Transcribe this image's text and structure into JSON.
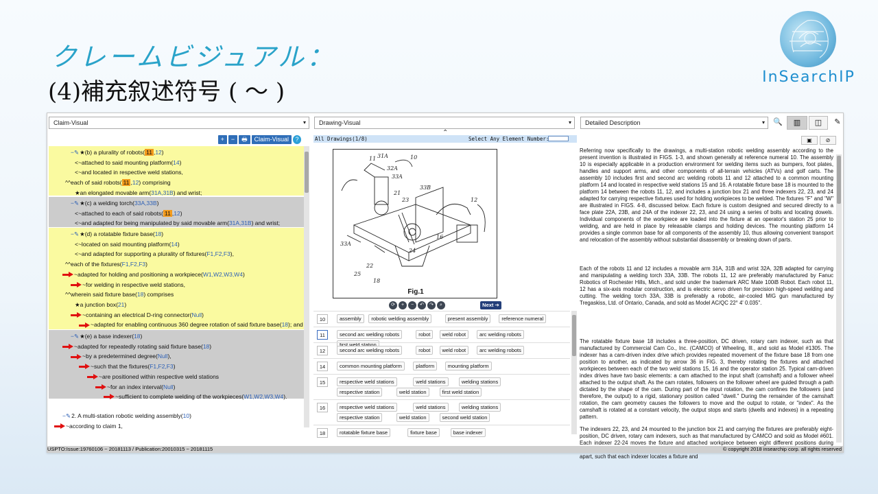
{
  "slide": {
    "title": "クレームビジュアル：",
    "subtitle": "(4)補充叙述符号 ( ～ )",
    "logo_text": "InSearchIP"
  },
  "selects": {
    "left": "Claim-Visual",
    "mid": "Drawing-Visual",
    "right": "Detailed Description"
  },
  "toolbar_icons": [
    "search-icon",
    "two-column-icon",
    "split-view-icon",
    "highlighter-icon"
  ],
  "left_tools": {
    "plus": "+",
    "minus": "−",
    "print": "🖶",
    "link": "☁",
    "view": "Claim-Visual",
    "help": "?"
  },
  "claims": {
    "b": [
      "★(b) a plurality of robots(",
      "11",
      ",",
      "12",
      ")",
      "<~attached to said mounting platform(",
      "14",
      ")",
      "<~and located in respective weld stations,",
      "^^each of said robots(",
      "11",
      ",",
      "12",
      ") comprising",
      "★an elongated movable arm(",
      "31A,31B",
      ") and wrist;"
    ],
    "c": [
      "★(c) a welding torch(",
      "33A,33B",
      ")",
      "<~attached to each of said robots(",
      "11",
      ",",
      "12",
      ")",
      "<~and adapted for being manipulated by said movable arm(",
      "31A,31B",
      ") and wrist;"
    ],
    "d": [
      "★(d) a rotatable fixture base(",
      "18",
      ")",
      "<~located on said mounting platform(",
      "14",
      ")",
      "<~and adapted for supporting a plurality of fixtures(",
      "F1,F2,F3",
      "),",
      "^^each of the fixtures(",
      "F1,F2,F3",
      ")",
      "~adapted for holding and positioning a workpiece(",
      "W1,W2,W3,W4",
      ")",
      "~for welding in respective weld stations,",
      "^^wherein said fixture base(",
      "18",
      ") comprises",
      "★a junction box(",
      "21",
      ")",
      "~containing an electrical D-ring connector(",
      "Null",
      ")",
      "~adapted for enabling continuous 360 degree rotation of said fixture base(",
      "18",
      "); and"
    ],
    "e": [
      "★(e) a base indexer(",
      "18",
      ")",
      "~adapted for repeatedly rotating said fixture base(",
      "18",
      ")",
      "~by a predetermined degree(",
      "Null",
      "),",
      "~such that the fixtures(",
      "F1,F2,F3",
      ")",
      "~are positioned within respective weld stations",
      "~for an index interval(",
      "Null",
      ")",
      "~sufficient to complete welding of the workpieces(",
      "W1,W2,W3,W4",
      ")."
    ],
    "c2": [
      "2. A multi-station robotic welding assembly(",
      "10",
      ")",
      "~according to claim 1,"
    ]
  },
  "drawing": {
    "header": "All Drawings(1/8)",
    "select_label": "Select Any Element Number:",
    "fig": "Fig.1",
    "next": "Next"
  },
  "element_rows": [
    {
      "num": "10",
      "tags": [
        "assembly",
        "robotic welding assembly",
        "present assembly",
        "reference numeral"
      ]
    },
    {
      "num": "11",
      "tags": [
        "second arc welding robots",
        "robot",
        "weld robot",
        "arc welding robots",
        "first weld station"
      ]
    },
    {
      "num": "12",
      "tags": [
        "second arc welding robots",
        "robot",
        "weld robot",
        "arc welding robots"
      ]
    },
    {
      "num": "14",
      "tags": [
        "common mounting platform",
        "platform",
        "mounting platform"
      ]
    },
    {
      "num": "15",
      "tags": [
        "respective weld stations",
        "weld stations",
        "welding stations",
        "respective station",
        "weld station",
        "first weld station"
      ]
    },
    {
      "num": "16",
      "tags": [
        "respective weld stations",
        "weld stations",
        "welding stations",
        "respective station",
        "weld station",
        "second weld station"
      ]
    },
    {
      "num": "18",
      "tags": [
        "rotatable fixture base",
        "fixture base",
        "base indexer"
      ]
    }
  ],
  "description": [
    "Referring now specifically to the drawings, a multi-station robotic welding assembly according to the present invention is illustrated in FIGS. 1-3, and shown generally at reference numeral 10. The assembly 10 is especially applicable in a production environment for welding items such as bumpers, foot plates, handles and support arms, and other components of all-terrain vehicles (ATVs) and golf carts. The assembly 10 includes first and second arc welding robots 11 and 12 attached to a common mounting platform 14 and located in respective weld stations 15 and 16. A rotatable fixture base 18 is mounted to the platform 14 between the robots 11, 12, and includes a junction box 21 and three indexers 22, 23, and 24 adapted for carrying respective fixtures used for holding workpieces to be welded. The fixtures \"F\" and \"W\" are illustrated in FIGS. 4-8, discussed below. Each fixture is custom designed and secured directly to a face plate 22A, 23B, and 24A of the indexer 22, 23, and 24 using a series of bolts and locating dowels. Individual components of the workpiece are loaded into the fixture at an operator's station 25 prior to welding, and are held in place by releasable clamps and holding devices. The mounting platform 14 provides a single common base for all components of the assembly 10, thus allowing convenient transport and relocation of the assembly without substantial disassembly or breaking down of parts.",
    "Each of the robots 11 and 12 includes a movable arm 31A, 31B and wrist 32A, 32B adapted for carrying and manipulating a welding torch 33A, 33B. The robots 11, 12 are preferably manufactured by Fanuc Robotics of Rochester Hills, Mich., and sold under the trademark ARC Mate 100iB Robot. Each robot 11, 12 has a six-axis modular construction, and is electric servo driven for precision high-speed welding and cutting. The welding torch 33A, 33B is preferably a robotic, air-cooled MIG gun manufactured by Tregaskiss, Ltd. of Ontario, Canada, and sold as Model AC/QC 22° 4' 0.035\".",
    "The rotatable fixture base 18 includes a three-position, DC driven, rotary cam indexer, such as that manufactured by Commercial Cam Co., Inc. (CAMCO) of Wheeling, Ill., and sold as Model #1305. The indexer has a cam-driven index drive which provides repeated movement of the fixture base 18 from one position to another, as indicated by arrow 36 in FIG. 3, thereby rotating the fixtures and attached workpieces between each of the two weld stations 15, 16 and the operator station 25. Typical cam-driven index drives have two basic elements: a cam attached to the input shaft (camshaft) and a follower wheel attached to the output shaft. As the cam rotates, followers on the follower wheel are guided through a path dictated by the shape of the cam. During part of the input rotation, the cam confines the followers (and therefore, the output) to a rigid, stationary position called \"dwell.\" During the remainder of the camshaft rotation, the cam geometry causes the followers to move and the output to rotate, or \"index\". As the camshaft is rotated at a constant velocity, the output stops and starts (dwells and indexes) in a repeating pattern.",
    "The indexers 22, 23, and 24 mounted to the junction box 21 and carrying the fixtures are preferably eight-position, DC driven, rotary cam indexers, such as that manufactured by CAMCO and sold as Model #601. Each indexer 22-24 moves the fixture and attached workpiece between eight different positions during welding in each of the welding stations 15 and 16. The fixture indexers 22-24 are spaced 120 degrees apart, such that each indexer locates a fixture and"
  ],
  "status": {
    "left": "USPTO:Issue:19760106 ~ 20181113 / Publication:20010315 ~ 20181115",
    "right": "© copyright 2018 insearchip corp. all rights reserved"
  }
}
